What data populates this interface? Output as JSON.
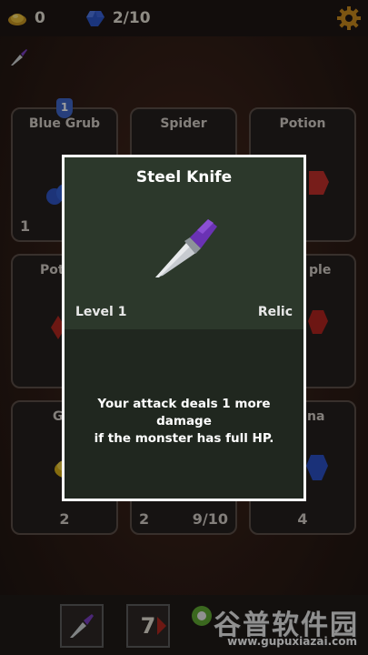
{
  "topbar": {
    "gold_icon": "gold-pile-icon",
    "gold_count": "0",
    "gem_icon": "blue-gem-icon",
    "gem_count": "2/10",
    "settings_icon": "gear-icon"
  },
  "equipped_icon": "knife-icon",
  "cards": [
    {
      "title": "Blue Grub",
      "bottom_left": "1",
      "badge": "1"
    },
    {
      "title": "Spider"
    },
    {
      "title": "Potion"
    },
    {
      "title": "Pot"
    },
    {
      "title": "ple"
    },
    {
      "title": "Go",
      "bottom_center": "2"
    },
    {
      "bottom_left": "2",
      "bottom_right": "9/10"
    },
    {
      "title": "na",
      "bottom_center": "4"
    }
  ],
  "bottombar": {
    "slot1_icon": "knife-icon",
    "slot2_value": "7"
  },
  "modal": {
    "title": "Steel Knife",
    "level": "Level 1",
    "type": "Relic",
    "description_line1": "Your attack deals 1 more damage",
    "description_line2": "if the monster has full HP."
  },
  "watermark": {
    "main": "谷普软件园",
    "url": "www.gupuxiazai.com"
  },
  "colors": {
    "modal_border": "#ffffff",
    "modal_top": "#2c382b",
    "modal_bottom": "#20271f",
    "knife_handle": "#7a3fc0",
    "gem_blue": "#2f5bd6",
    "gold": "#e0b02c"
  }
}
